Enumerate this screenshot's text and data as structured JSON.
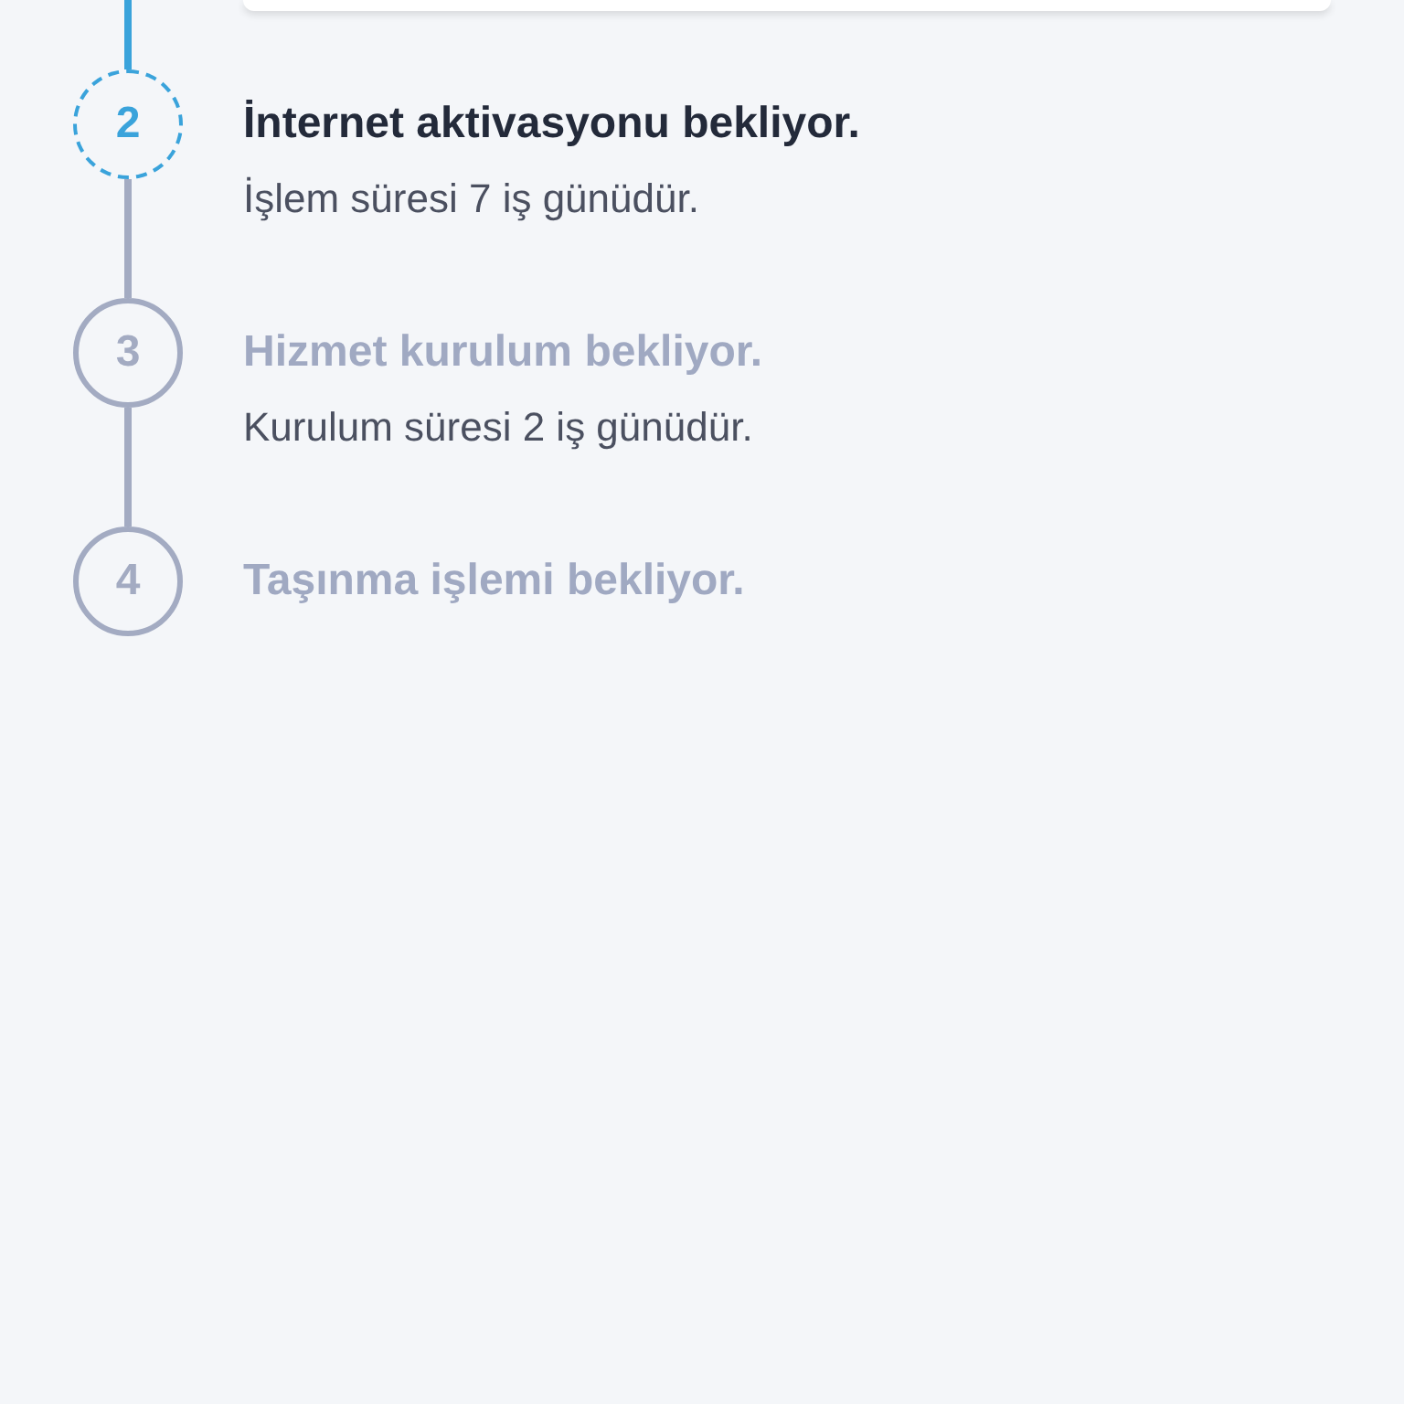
{
  "steps": [
    {
      "number": "2",
      "active": true,
      "title": "İnternet aktivasyonu bekliyor.",
      "description": "İşlem süresi 7 iş günüdür."
    },
    {
      "number": "3",
      "active": false,
      "title": "Hizmet kurulum bekliyor.",
      "description": "Kurulum süresi 2 iş günüdür."
    },
    {
      "number": "4",
      "active": false,
      "title": "Taşınma işlemi bekliyor."
    }
  ]
}
